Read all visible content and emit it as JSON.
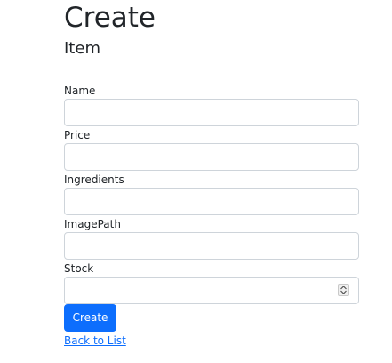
{
  "page": {
    "title": "Create",
    "subtitle": "Item"
  },
  "form": {
    "fields": [
      {
        "label": "Name",
        "value": "",
        "placeholder": ""
      },
      {
        "label": "Price",
        "value": "",
        "placeholder": ""
      },
      {
        "label": "Ingredients",
        "value": "",
        "placeholder": ""
      },
      {
        "label": "ImagePath",
        "value": "",
        "placeholder": ""
      },
      {
        "label": "Stock",
        "value": "",
        "placeholder": ""
      }
    ],
    "submit_label": "Create"
  },
  "links": {
    "back_label": "Back to List"
  },
  "colors": {
    "primary": "#0d6efd",
    "input_border": "#ced4da",
    "divider": "#c8c8c8",
    "text": "#212529"
  },
  "icons": {
    "stock_spinner": "number-spinner-icon"
  }
}
